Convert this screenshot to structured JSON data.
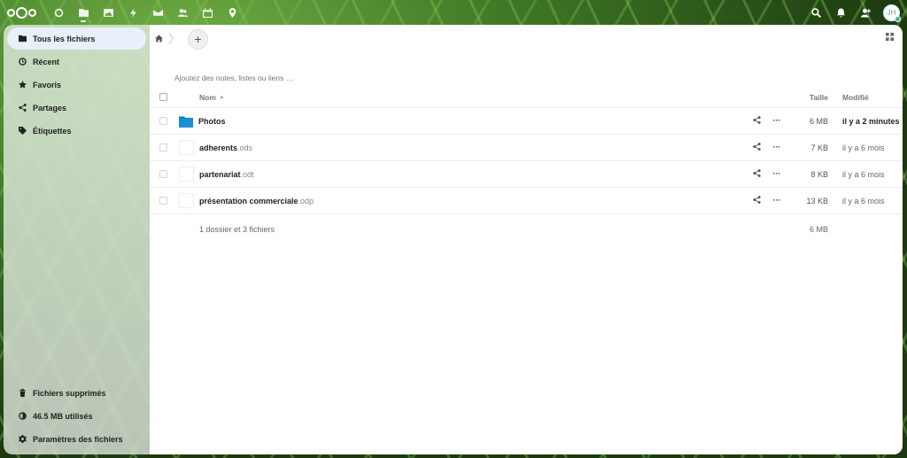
{
  "header": {
    "apps": [
      {
        "name": "dashboard-icon"
      },
      {
        "name": "files-icon",
        "active": true
      },
      {
        "name": "photos-icon"
      },
      {
        "name": "activity-icon"
      },
      {
        "name": "mail-icon"
      },
      {
        "name": "contacts-icon"
      },
      {
        "name": "calendar-icon"
      },
      {
        "name": "maps-icon"
      }
    ],
    "avatar_initials": "JH"
  },
  "sidebar": {
    "items": [
      {
        "label": "Tous les fichiers",
        "icon": "folder-icon",
        "active": true
      },
      {
        "label": "Récent",
        "icon": "clock-icon"
      },
      {
        "label": "Favoris",
        "icon": "star-icon"
      },
      {
        "label": "Partages",
        "icon": "share-icon"
      },
      {
        "label": "Étiquettes",
        "icon": "tag-icon"
      }
    ],
    "bottom": [
      {
        "label": "Fichiers supprimés",
        "icon": "trash-icon"
      },
      {
        "label": "46.5 MB utilisés",
        "icon": "quota-icon"
      },
      {
        "label": "Paramètres des fichiers",
        "icon": "gear-icon"
      }
    ]
  },
  "main": {
    "add_label": "+",
    "notes_placeholder": "Ajoutez des notes, listes ou liens …",
    "columns": {
      "name": "Nom",
      "sort_arrow": "▴",
      "size": "Taille",
      "modified": "Modifié"
    },
    "rows": [
      {
        "name": "Photos",
        "ext": "",
        "type": "folder",
        "size": "6 MB",
        "modified": "il y a 2 minutes",
        "recent": true
      },
      {
        "name": "adherents",
        "ext": ".ods",
        "type": "file",
        "size": "7 KB",
        "modified": "il y a 6 mois"
      },
      {
        "name": "partenariat",
        "ext": ".odt",
        "type": "file",
        "size": "8 KB",
        "modified": "il y a 6 mois"
      },
      {
        "name": "présentation commerciale",
        "ext": ".odp",
        "type": "file",
        "size": "13 KB",
        "modified": "il y a 6 mois"
      }
    ],
    "summary": {
      "text": "1 dossier et 3 fichiers",
      "size": "6 MB"
    }
  },
  "colors": {
    "accent": "#0082c9",
    "active_nav": "#e8f0fa"
  }
}
